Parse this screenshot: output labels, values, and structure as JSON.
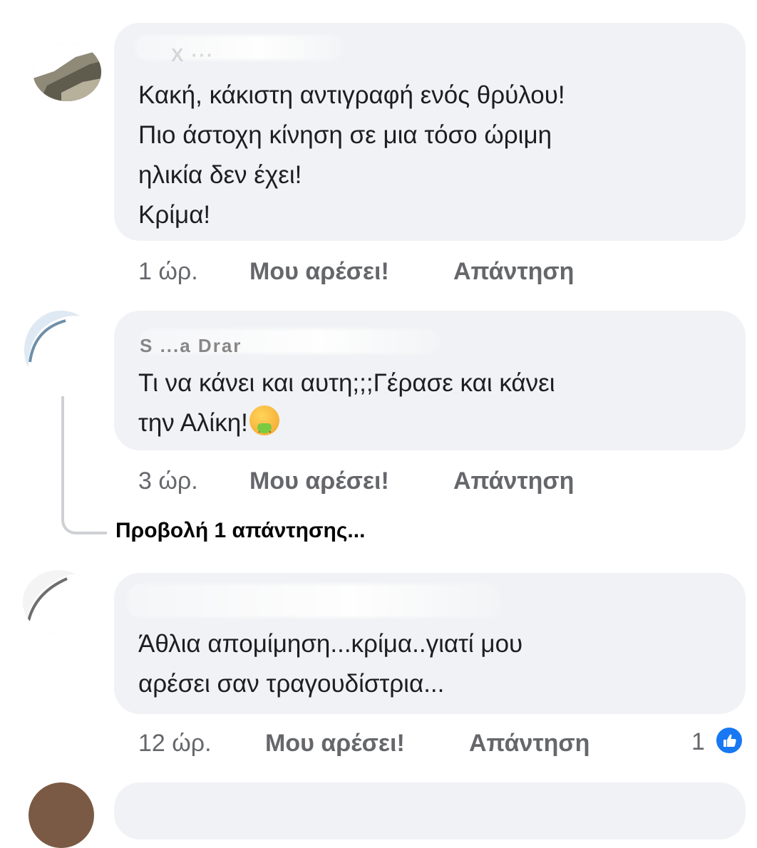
{
  "comments": [
    {
      "author": "X ···",
      "lines": [
        "Κακή, κάκιστη αντιγραφή ενός θρύλου!",
        "Πιο άστοχη κίνηση σε μια τόσο ώριμη",
        "ηλικία δεν έχει!",
        "Κρίμα!"
      ],
      "time": "1 ώρ.",
      "like_label": "Μου αρέσει!",
      "reply_label": "Απάντηση"
    },
    {
      "author": "S    ...a Drar",
      "lines": [
        "Τι να κάνει και αυτη;;;Γέρασε και κάνει",
        "την Αλίκη!"
      ],
      "emoji": "nauseated-face-icon",
      "time": "3 ώρ.",
      "like_label": "Μου αρέσει!",
      "reply_label": "Απάντηση",
      "view_replies": "Προβολή 1 απάντησης..."
    },
    {
      "author": "",
      "lines": [
        "Άθλια απομίμηση...κρίμα..γιατί μου",
        "αρέσει σαν τραγουδίστρια..."
      ],
      "time": "12 ώρ.",
      "like_label": "Μου αρέσει!",
      "reply_label": "Απάντηση",
      "reaction_count": "1"
    }
  ],
  "colors": {
    "bubble": "#f0f2f5",
    "meta_text": "#65676b",
    "like_blue": "#1877f2"
  }
}
